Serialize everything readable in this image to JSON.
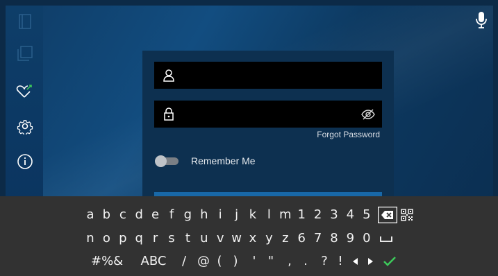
{
  "login": {
    "username_value": "",
    "password_value": "",
    "forgot_label": "Forgot Password",
    "remember_label": "Remember Me",
    "remember_on": false
  },
  "icons": {
    "sidebar": [
      "book-icon",
      "gallery-icon",
      "favorite-icon",
      "gear-icon",
      "info-icon"
    ],
    "top_right": "microphone-icon"
  },
  "keyboard": {
    "row1": [
      "a",
      "b",
      "c",
      "d",
      "e",
      "f",
      "g",
      "h",
      "i",
      "j",
      "k",
      "l",
      "m",
      "1",
      "2",
      "3",
      "4",
      "5"
    ],
    "row2": [
      "n",
      "o",
      "p",
      "q",
      "r",
      "s",
      "t",
      "u",
      "v",
      "w",
      "x",
      "y",
      "z",
      "6",
      "7",
      "8",
      "9",
      "0"
    ],
    "row3": [
      "#%&",
      "ABC",
      "/",
      "@",
      "(",
      ")",
      "'",
      "\"",
      ",",
      ".",
      "?",
      "!"
    ]
  },
  "colors": {
    "accent_check": "#3cc85a",
    "card_bg": "#0d3050",
    "keyboard_bg": "#323232"
  }
}
